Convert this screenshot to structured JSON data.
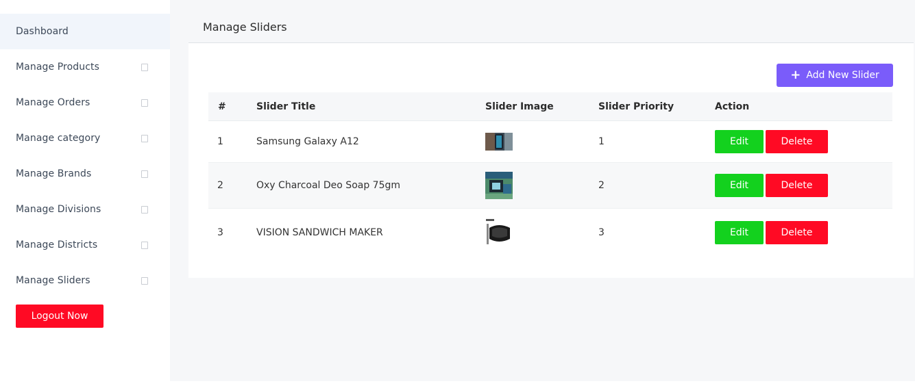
{
  "sidebar": {
    "items": [
      {
        "label": "Dashboard"
      },
      {
        "label": "Manage Products"
      },
      {
        "label": "Manage Orders"
      },
      {
        "label": "Manage category"
      },
      {
        "label": "Manage Brands"
      },
      {
        "label": "Manage Divisions"
      },
      {
        "label": "Manage Districts"
      },
      {
        "label": "Manage Sliders"
      }
    ],
    "logout_label": "Logout Now"
  },
  "page": {
    "title": "Manage Sliders",
    "add_button_label": "Add New Slider"
  },
  "table": {
    "headers": [
      "#",
      "Slider Title",
      "Slider Image",
      "Slider Priority",
      "Action"
    ],
    "rows": [
      {
        "index": "1",
        "title": "Samsung Galaxy A12",
        "priority": "1",
        "edit_label": "Edit",
        "delete_label": "Delete"
      },
      {
        "index": "2",
        "title": "Oxy Charcoal Deo Soap 75gm",
        "priority": "2",
        "edit_label": "Edit",
        "delete_label": "Delete"
      },
      {
        "index": "3",
        "title": "VISION SANDWICH MAKER",
        "priority": "3",
        "edit_label": "Edit",
        "delete_label": "Delete"
      }
    ]
  },
  "colors": {
    "accent_purple": "#7a5cfa",
    "edit_green": "#13d11e",
    "delete_red": "#ff0a24",
    "active_bg": "#f1f5fb"
  },
  "icons": {
    "sidebar_chevron": "chevron-placeholder-icon",
    "add": "plus-icon"
  }
}
